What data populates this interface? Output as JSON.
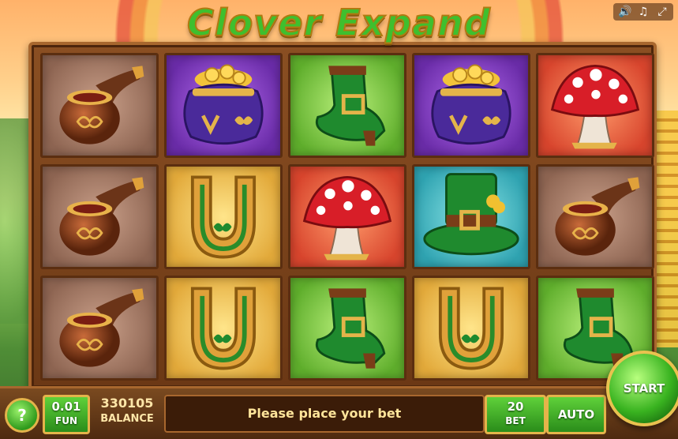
{
  "logo": {
    "text": "Clover Expand"
  },
  "top_icons": [
    "sound-icon",
    "music-icon",
    "fullscreen-icon"
  ],
  "reels": [
    [
      "pipe",
      "pipe",
      "pipe"
    ],
    [
      "gold-pot",
      "horseshoe",
      "horseshoe"
    ],
    [
      "boot",
      "mushroom",
      "boot"
    ],
    [
      "gold-pot",
      "top-hat",
      "horseshoe"
    ],
    [
      "mushroom",
      "pipe",
      "boot"
    ]
  ],
  "controls": {
    "help_label": "?",
    "coin_value": "0.01",
    "coin_label": "FUN",
    "balance_value": "330105",
    "balance_label": "BALANCE",
    "message": "Please place your bet",
    "bet_value": "20",
    "bet_label": "BET",
    "auto_label": "AUTO",
    "start_label": "START"
  }
}
